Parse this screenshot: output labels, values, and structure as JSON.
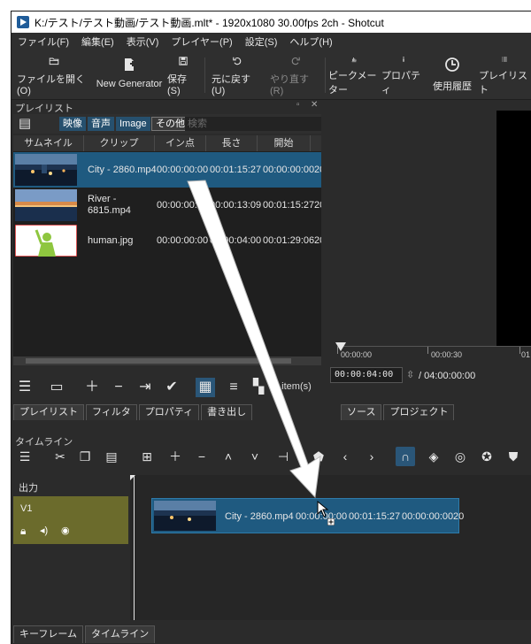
{
  "window": {
    "title": "K:/テスト/テスト動画/テスト動画.mlt* - 1920x1080 30.00fps 2ch - Shotcut"
  },
  "menu": [
    "ファイル(F)",
    "編集(E)",
    "表示(V)",
    "プレイヤー(P)",
    "設定(S)",
    "ヘルプ(H)"
  ],
  "toolbar": {
    "open": "ファイルを開く(O)",
    "new_generator": "New Generator",
    "save": "保存(S)",
    "undo": "元に戻す(U)",
    "redo": "やり直す(R)",
    "peak_meter": "ピークメーター",
    "properties": "プロパティ",
    "history": "使用履歴",
    "playlist": "プレイリスト"
  },
  "playlist": {
    "title": "プレイリスト",
    "filters": [
      "映像",
      "音声",
      "Image",
      "その他"
    ],
    "search_placeholder": "検索",
    "columns": [
      "サムネイル",
      "クリップ",
      "イン点",
      "長さ",
      "開始"
    ],
    "rows": [
      {
        "clip": "City - 2860.mp4",
        "in": "00:00:00:00",
        "length": "00:01:15:27",
        "start": "00:00:00:00",
        "extra": "20",
        "thumb": "city-thumbnail",
        "selected": true
      },
      {
        "clip": "River - 6815.mp4",
        "in": "00:00:00:00",
        "length": "00:00:13:09",
        "start": "00:01:15:27",
        "extra": "20",
        "thumb": "river-thumbnail",
        "selected": false
      },
      {
        "clip": "human.jpg",
        "in": "00:00:00:00",
        "length": "00:00:04:00",
        "start": "00:01:29:06",
        "extra": "20",
        "thumb": "human-thumbnail",
        "selected": false
      }
    ],
    "item_count": "3 item(s)",
    "tabs": [
      "プレイリスト",
      "フィルタ",
      "プロパティ",
      "書き出し"
    ]
  },
  "preview": {
    "ruler": [
      "00:00:00",
      "00:00:30",
      "01"
    ],
    "timecode": "00:00:04:00",
    "total": "/  04:00:00:00",
    "tabs": [
      "ソース",
      "プロジェクト"
    ]
  },
  "timeline": {
    "title": "タイムライン",
    "output_label": "出力",
    "track": "V1",
    "clip": {
      "name": "City - 2860.mp4",
      "in": "00:00:00:00",
      "length": "00:01:15:27",
      "start": "00:00:00:00",
      "extra": "20"
    },
    "bottom_tabs": [
      "キーフレーム",
      "タイムライン"
    ]
  },
  "colors": {
    "accent": "#1f5a80",
    "track_head": "#6b6b2c",
    "snap_on": "#2a5678"
  }
}
